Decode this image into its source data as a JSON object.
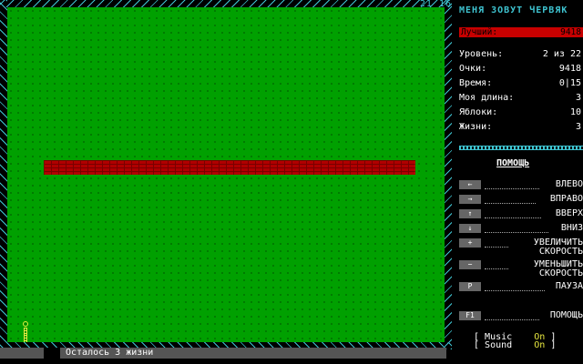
{
  "hud": {
    "coords": "21 16",
    "status": "Осталось 3 жизни"
  },
  "panel": {
    "title": "МЕНЯ ЗОВУТ ЧЕРВЯК",
    "best_label": "Лучший:",
    "best_value": "9418",
    "stats": [
      {
        "label": "Уровень:",
        "value": "2 из 22"
      },
      {
        "label": "Очки:",
        "value": "9418"
      },
      {
        "label": "Время:",
        "value": "0|15"
      },
      {
        "label": "Моя длина:",
        "value": "3"
      },
      {
        "label": "Яблоки:",
        "value": "10"
      },
      {
        "label": "Жизни:",
        "value": "3"
      }
    ],
    "help_title": "ПОМОЩЬ",
    "help": [
      {
        "key": "←",
        "action": "ВЛЕВО"
      },
      {
        "key": "→",
        "action": "ВПРАВО"
      },
      {
        "key": "↑",
        "action": "ВВЕРХ"
      },
      {
        "key": "↓",
        "action": "ВНИЗ"
      },
      {
        "key": "+",
        "action": "УВЕЛИЧИТЬ СКОРОСТЬ"
      },
      {
        "key": "−",
        "action": "УМЕНЬШИТЬ СКОРОСТЬ"
      },
      {
        "key": "P",
        "action": "ПАУЗА"
      },
      {
        "key": "F1",
        "action": "ПОМОЩЬ"
      }
    ],
    "options": [
      {
        "label": "Music",
        "value": "On"
      },
      {
        "label": "Sound",
        "value": "On"
      }
    ]
  },
  "colors": {
    "field": "#00a000",
    "wall": "#b00000",
    "border": "#3ec3d0",
    "worm": "#e8e840",
    "best_bar": "#c80000"
  }
}
